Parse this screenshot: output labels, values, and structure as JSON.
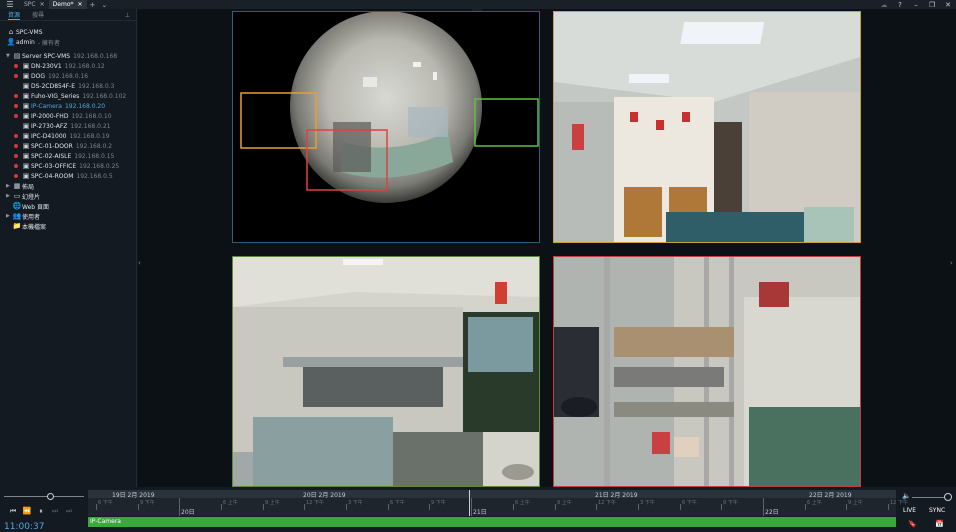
{
  "titlebar": {
    "tabs": [
      {
        "label": "SPC",
        "active": false
      },
      {
        "label": "Demo*",
        "active": true
      }
    ]
  },
  "sidebar": {
    "tabs": [
      "資源",
      "搜尋"
    ],
    "site": "SPC-VMS",
    "user": "admin",
    "user_role": "- 擁有者",
    "server": {
      "label": "Server SPC-VMS",
      "ip": "192.168.0.168"
    },
    "cameras": [
      {
        "label": "DN-230V1",
        "ip": "192.168.0.12",
        "status": "red"
      },
      {
        "label": "DOG",
        "ip": "192.168.0.16",
        "status": "red"
      },
      {
        "label": "DS-2CD854F-E",
        "ip": "192.168.0.3",
        "status": "none"
      },
      {
        "label": "Fuho-VIG_Series",
        "ip": "192.168.0.102",
        "status": "red"
      },
      {
        "label": "IP-Camera",
        "ip": "192.168.0.20",
        "status": "red",
        "selected": true
      },
      {
        "label": "IP-2000-FHD",
        "ip": "192.168.0.10",
        "status": "red"
      },
      {
        "label": "IP-2730-AFZ",
        "ip": "192.168.0.21",
        "status": "none"
      },
      {
        "label": "IPC-D41000",
        "ip": "192.168.0.19",
        "status": "red"
      },
      {
        "label": "SPC-01-DOOR",
        "ip": "192.168.0.2",
        "status": "red"
      },
      {
        "label": "SPC-02-AISLE",
        "ip": "192.168.0.15",
        "status": "red"
      },
      {
        "label": "SPC-03-OFFICE",
        "ip": "192.168.0.25",
        "status": "red"
      },
      {
        "label": "SPC-04-ROOM",
        "ip": "192.168.0.5",
        "status": "red"
      }
    ],
    "others": [
      {
        "label": "佈局",
        "icon": "layout-icon"
      },
      {
        "label": "幻燈片",
        "icon": "slideshow-icon"
      },
      {
        "label": "Web 頁面",
        "icon": "web-icon"
      },
      {
        "label": "使用者",
        "icon": "users-icon"
      },
      {
        "label": "本機檔案",
        "icon": "folder-icon"
      }
    ]
  },
  "bottom": {
    "clock": "11:00:37",
    "playback_position": 0.55,
    "days": [
      {
        "label": "19日 2月 2019"
      },
      {
        "label": "20日 2月 2019"
      },
      {
        "label": "21日 2月 2019"
      },
      {
        "label": "22日 2月 2019"
      }
    ],
    "hour_labels": [
      "6 下午",
      "9 下午",
      "20日",
      "6 上午",
      "9 上午",
      "12 下午",
      "3 下午",
      "6 下午",
      "9 下午",
      "21日",
      "6 上午",
      "9 上午",
      "12 下午",
      "3 下午",
      "6 下午",
      "9 下午",
      "22日",
      "6 上午",
      "9 上午",
      "12 下午"
    ],
    "track_label": "IP-Camera",
    "live_label": "LIVE",
    "sync_label": "SYNC"
  },
  "colors": {
    "accent": "#4fa8e0",
    "track": "#3aa83a",
    "status_red": "#d23a3a"
  }
}
